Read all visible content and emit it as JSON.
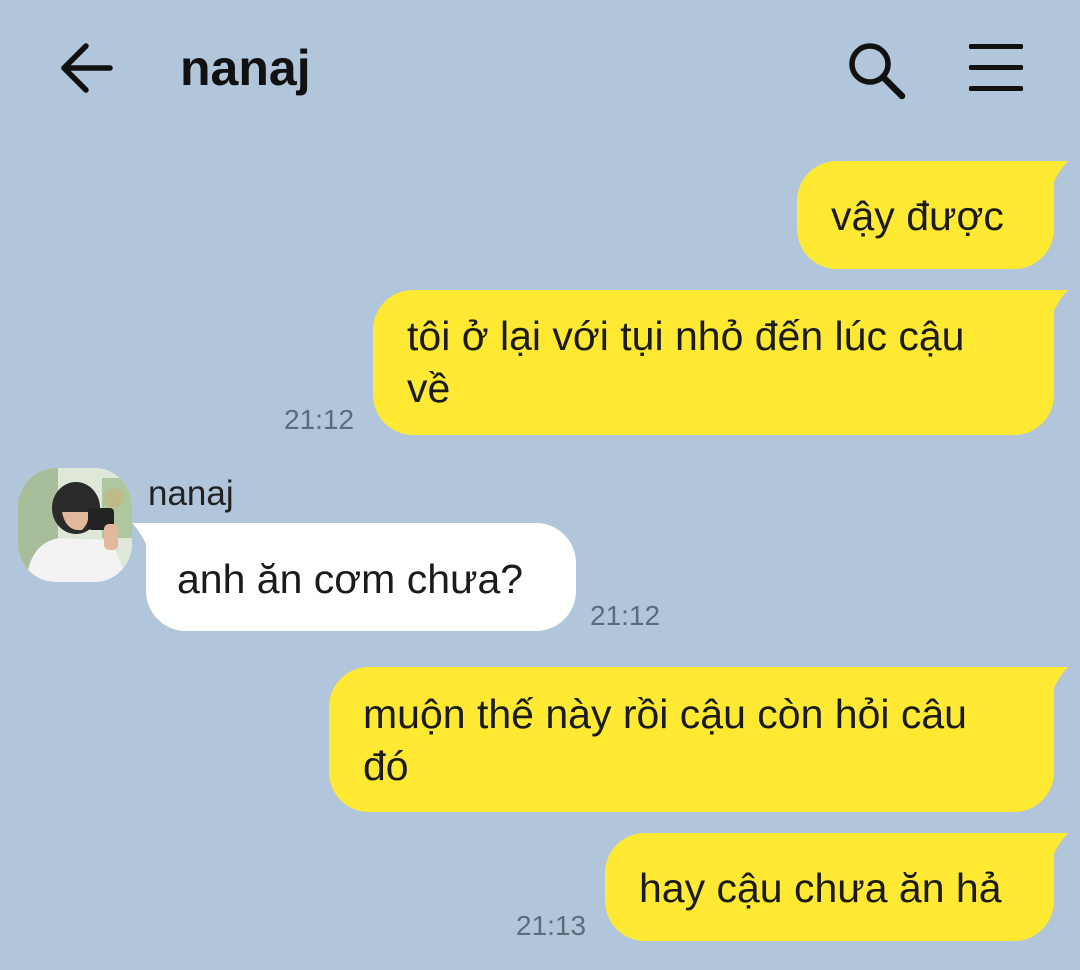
{
  "header": {
    "title": "nanaj",
    "back_icon": "arrow-left-icon",
    "search_icon": "search-icon",
    "menu_icon": "hamburger-menu-icon"
  },
  "colors": {
    "background": "#b1c6da",
    "outgoing_bubble": "#ffe933",
    "incoming_bubble": "#ffffff",
    "timestamp": "#5e6b78"
  },
  "messages": [
    {
      "direction": "outgoing",
      "text": "vậy được",
      "time": ""
    },
    {
      "direction": "outgoing",
      "text": "tôi ở lại với tụi nhỏ đến lúc cậu\nvề",
      "time": "21:12"
    },
    {
      "direction": "incoming",
      "sender": "nanaj",
      "avatar": "profile-photo-avatar",
      "text": "anh ăn cơm chưa?",
      "time": "21:12"
    },
    {
      "direction": "outgoing",
      "text": "muộn thế này rồi cậu còn hỏi câu\nđó",
      "time": ""
    },
    {
      "direction": "outgoing",
      "text": "hay cậu chưa ăn hả",
      "time": "21:13"
    }
  ]
}
